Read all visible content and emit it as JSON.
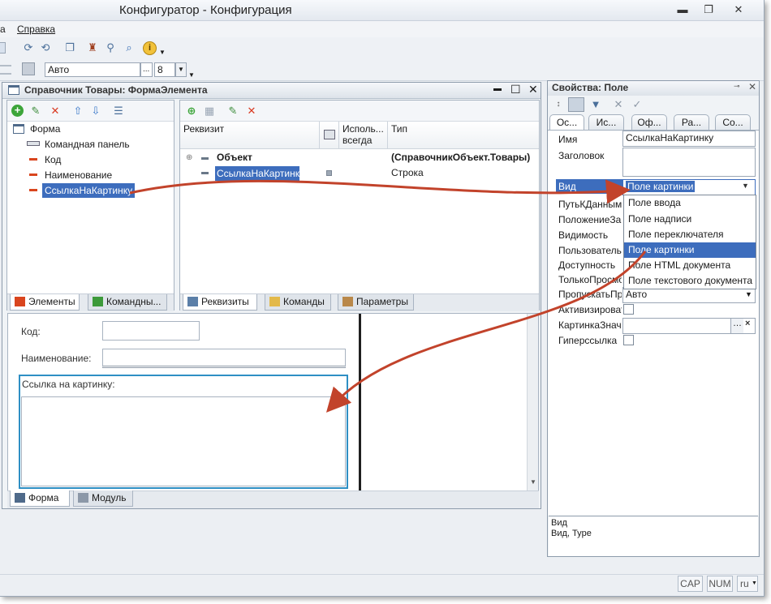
{
  "window": {
    "title": "Конфигуратор - Конфигурация",
    "controls": {
      "minimize": "▬",
      "maximize": "❐",
      "close": "✕"
    }
  },
  "menu": {
    "items": [
      "а",
      "Справка"
    ]
  },
  "toolbar2": {
    "font_combo": "Авто",
    "font_ellipsis": "...",
    "size_combo": "8"
  },
  "form_window": {
    "title": "Справочник Товары: ФормаЭлемента",
    "controls": {
      "minimize": "▬",
      "maximize": "☐",
      "close": "✕"
    },
    "tree": {
      "items": [
        {
          "label": "Форма"
        },
        {
          "label": "Командная панель"
        },
        {
          "label": "Код"
        },
        {
          "label": "Наименование"
        },
        {
          "label": "СсылкаНаКартинку"
        }
      ]
    },
    "tree_tabs": [
      "Элементы",
      "Командны..."
    ],
    "attributes": {
      "headers": {
        "col1": "Реквизит",
        "col2_line1": "Исполь...",
        "col2_line2": "всегда",
        "col3": "Тип"
      },
      "rows": [
        {
          "name": "Объект",
          "type": "(СправочникОбъект.Товары)"
        },
        {
          "name": "СсылкаНаКартинку",
          "type": "Строка"
        }
      ]
    },
    "attr_tabs": [
      "Реквизиты",
      "Команды",
      "Параметры"
    ],
    "preview": {
      "code_label": "Код:",
      "name_label": "Наименование:",
      "picture_label": "Ссылка на картинку:"
    },
    "bottom_tabs": [
      "Форма",
      "Модуль"
    ]
  },
  "properties": {
    "title": "Свойства: Поле",
    "tabs": [
      "Ос...",
      "Ис...",
      "Оф...",
      "Ра...",
      "Со..."
    ],
    "rows": [
      {
        "label": "Имя",
        "value": "СсылкаНаКартинку"
      },
      {
        "label": "Заголовок",
        "value": ""
      },
      {
        "label": "Вид",
        "value": "Поле картинки"
      },
      {
        "label": "ПутьКДанным",
        "value": ""
      },
      {
        "label": "ПоложениеЗаго",
        "value": ""
      },
      {
        "label": "Видимость",
        "value": ""
      },
      {
        "label": "Пользовательс",
        "value": ""
      },
      {
        "label": "Доступность",
        "value": ""
      },
      {
        "label": "ТолькоПросмо",
        "value": ""
      },
      {
        "label": "ПропускатьПри",
        "value": "Авто"
      },
      {
        "label": "Активизироват",
        "value": ""
      },
      {
        "label": "КартинкаЗначе",
        "value": ""
      },
      {
        "label": "Гиперссылка",
        "value": ""
      }
    ],
    "dropdown_options": [
      "Поле ввода",
      "Поле надписи",
      "Поле переключателя",
      "Поле картинки",
      "Поле HTML документа",
      "Поле текстового документа"
    ],
    "dropdown_selected_index": 3,
    "help": {
      "line1": "Вид",
      "line2": "Вид, Type"
    }
  },
  "statusbar": {
    "cap": "CAP",
    "num": "NUM",
    "lang": "ru"
  },
  "colors": {
    "selection": "#3d6dbd",
    "arrow": "#c2432b",
    "frame_highlight": "#2e8fc4"
  }
}
